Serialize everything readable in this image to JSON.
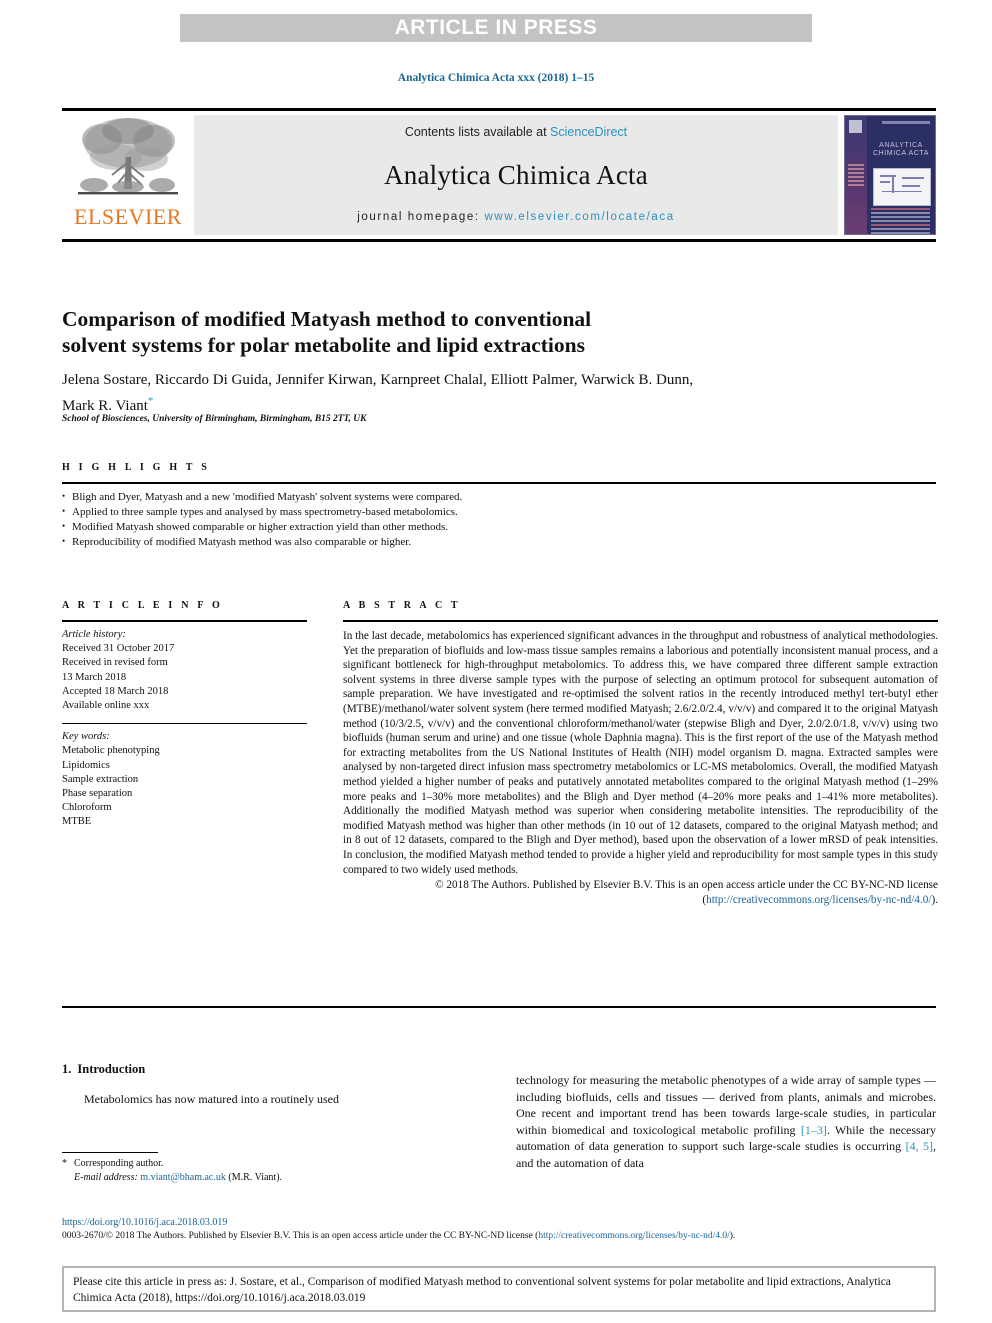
{
  "banner": {
    "text": "ARTICLE IN PRESS"
  },
  "journal_ref": "Analytica Chimica Acta xxx (2018) 1–15",
  "masthead": {
    "publisher": "ELSEVIER",
    "contents_prefix": "Contents lists available at ",
    "contents_link": "ScienceDirect",
    "journal_name": "Analytica Chimica Acta",
    "homepage_prefix": "journal homepage: ",
    "homepage_url": "www.elsevier.com/locate/aca",
    "cover_title": "ANALYTICA CHIMICA ACTA"
  },
  "article": {
    "title": "Comparison of modified Matyash method to conventional solvent systems for polar metabolite and lipid extractions",
    "authors": "Jelena Sostare, Riccardo Di Guida, Jennifer Kirwan, Karnpreet Chalal, Elliott Palmer, Warwick B. Dunn, Mark R. Viant",
    "corresponding_marker": "*",
    "affiliation": "School of Biosciences, University of Birmingham, Birmingham, B15 2TT, UK"
  },
  "highlights": {
    "heading": "H I G H L I G H T S",
    "items": [
      "Bligh and Dyer, Matyash and a new 'modified Matyash' solvent systems were compared.",
      "Applied to three sample types and analysed by mass spectrometry-based metabolomics.",
      "Modified Matyash showed comparable or higher extraction yield than other methods.",
      "Reproducibility of modified Matyash method was also comparable or higher."
    ]
  },
  "article_info": {
    "heading": "A R T I C L E   I N F O",
    "history_label": "Article history:",
    "history": [
      "Received 31 October 2017",
      "Received in revised form",
      "13 March 2018",
      "Accepted 18 March 2018",
      "Available online xxx"
    ],
    "keywords_label": "Key words:",
    "keywords": [
      "Metabolic phenotyping",
      "Lipidomics",
      "Sample extraction",
      "Phase separation",
      "Chloroform",
      "MTBE"
    ]
  },
  "abstract": {
    "heading": "A B S T R A C T",
    "text": "In the last decade, metabolomics has experienced significant advances in the throughput and robustness of analytical methodologies. Yet the preparation of biofluids and low-mass tissue samples remains a laborious and potentially inconsistent manual process, and a significant bottleneck for high-throughput metabolomics. To address this, we have compared three different sample extraction solvent systems in three diverse sample types with the purpose of selecting an optimum protocol for subsequent automation of sample preparation. We have investigated and re-optimised the solvent ratios in the recently introduced methyl tert-butyl ether (MTBE)/methanol/water solvent system (here termed modified Matyash; 2.6/2.0/2.4, v/v/v) and compared it to the original Matyash method (10/3/2.5, v/v/v) and the conventional chloroform/methanol/water (stepwise Bligh and Dyer, 2.0/2.0/1.8, v/v/v) using two biofluids (human serum and urine) and one tissue (whole Daphnia magna). This is the first report of the use of the Matyash method for extracting metabolites from the US National Institutes of Health (NIH) model organism D. magna. Extracted samples were analysed by non-targeted direct infusion mass spectrometry metabolomics or LC-MS metabolomics. Overall, the modified Matyash method yielded a higher number of peaks and putatively annotated metabolites compared to the original Matyash method (1–29% more peaks and 1–30% more metabolites) and the Bligh and Dyer method (4–20% more peaks and 1–41% more metabolites). Additionally the modified Matyash method was superior when considering metabolite intensities. The reproducibility of the modified Matyash method was higher than other methods (in 10 out of 12 datasets, compared to the original Matyash method; and in 8 out of 12 datasets, compared to the Bligh and Dyer method), based upon the observation of a lower mRSD of peak intensities. In conclusion, the modified Matyash method tended to provide a higher yield and reproducibility for most sample types in this study compared to two widely used methods.",
    "copyright_prefix": "© 2018 The Authors. Published by Elsevier B.V. This is an open access article under the CC BY-NC-ND license (",
    "copyright_link": "http://creativecommons.org/licenses/by-nc-nd/4.0/",
    "copyright_suffix": ")."
  },
  "introduction": {
    "number": "1.",
    "heading": "Introduction",
    "para_left": "Metabolomics has now matured into a routinely used",
    "para_right_1": "technology for measuring the metabolic phenotypes of a wide array of sample types — including biofluids, cells and tissues — derived from plants, animals and microbes. One recent and important trend has been towards large-scale studies, in particular within biomedical and toxicological metabolic profiling ",
    "cite_1": "[1–3]",
    "para_right_2": ". While the necessary automation of data generation to support such large-scale studies is occurring ",
    "cite_2": "[4, 5]",
    "para_right_3": ", and the automation of data"
  },
  "footnote": {
    "corresponding": "Corresponding author.",
    "email_label": "E-mail address:",
    "email": "m.viant@bham.ac.uk",
    "email_owner": "(M.R. Viant)."
  },
  "footer": {
    "doi": "https://doi.org/10.1016/j.aca.2018.03.019",
    "issn_prefix": "0003-2670/© 2018 The Authors. Published by Elsevier B.V. This is an open access article under the CC BY-NC-ND license (",
    "issn_link": "http://creativecommons.org/licenses/by-nc-nd/4.0/",
    "issn_suffix": ")."
  },
  "cite_box": {
    "text": "Please cite this article in press as: J. Sostare, et al., Comparison of modified Matyash method to conventional solvent systems for polar metabolite and lipid extractions, Analytica Chimica Acta (2018), https://doi.org/10.1016/j.aca.2018.03.019"
  },
  "colors": {
    "link_blue": "#1a6496",
    "link_light_blue": "#2b91bf",
    "elsevier_orange": "#e87722",
    "banner_gray": "#c2c3c5",
    "contents_gray": "#e9e9e9"
  }
}
